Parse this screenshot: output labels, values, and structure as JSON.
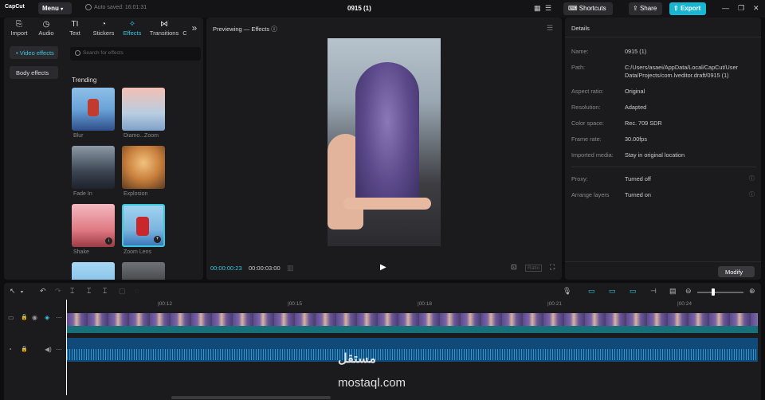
{
  "app": {
    "name": "CapCut",
    "menu_label": "Menu",
    "autosave": "Auto saved: 16:01:31",
    "project_title": "0915 (1)",
    "shortcuts_label": "Shortcuts",
    "share_label": "Share",
    "export_label": "Export",
    "accent": "#17b6d3"
  },
  "left_tabs": [
    {
      "label": "Import",
      "icon": "import-icon"
    },
    {
      "label": "Audio",
      "icon": "audio-icon"
    },
    {
      "label": "Text",
      "icon": "text-icon"
    },
    {
      "label": "Stickers",
      "icon": "stickers-icon"
    },
    {
      "label": "Effects",
      "icon": "effects-icon",
      "active": true
    },
    {
      "label": "Transitions",
      "icon": "transitions-icon"
    },
    {
      "label": "C",
      "icon": "more-icon"
    }
  ],
  "categories": [
    {
      "label": "• Video effects",
      "active": true
    },
    {
      "label": "Body effects"
    }
  ],
  "search": {
    "placeholder": "Search for effects"
  },
  "trending_label": "Trending",
  "effects": [
    {
      "label": "Blur"
    },
    {
      "label": "Diamo...Zoom"
    },
    {
      "label": "Fade In"
    },
    {
      "label": "Explosion"
    },
    {
      "label": "Shake"
    },
    {
      "label": "Zoom Lens"
    }
  ],
  "preview": {
    "title": "Previewing — Effects",
    "time_current": "00:00:00:23",
    "time_total": "00:00:03:00",
    "ratio_label": "Ratio"
  },
  "details": {
    "title": "Details",
    "rows": [
      {
        "key": "Name:",
        "value": "0915 (1)"
      },
      {
        "key": "Path:",
        "value": "C:/Users/asaei/AppData/Local/CapCut/User Data/Projects/com.lveditor.draft/0915 (1)"
      },
      {
        "key": "Aspect ratio:",
        "value": "Original"
      },
      {
        "key": "Resolution:",
        "value": "Adapted"
      },
      {
        "key": "Color space:",
        "value": "Rec. 709 SDR"
      },
      {
        "key": "Frame rate:",
        "value": "30.00fps"
      },
      {
        "key": "Imported media:",
        "value": "Stay in original location"
      },
      {
        "key": "Proxy:",
        "value": "Turned off"
      },
      {
        "key": "Arrange layers",
        "value": "Turned on"
      }
    ],
    "modify_label": "Modify"
  },
  "timeline": {
    "ticks": [
      "|00:12",
      "|00:15",
      "|00:18",
      "|00:21",
      "|00:24"
    ]
  },
  "watermark": {
    "ar": "مستقل",
    "en": "mostaql.com"
  }
}
